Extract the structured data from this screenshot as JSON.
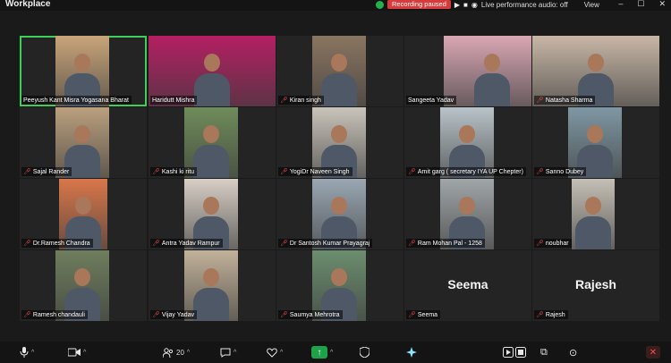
{
  "app": {
    "title": "Workplace"
  },
  "status": {
    "recording": "Recording paused",
    "live_audio": "Live performance audio: off",
    "view": "View"
  },
  "window_controls": {
    "minimize": "–",
    "maximize": "☐",
    "close": "✕"
  },
  "participants": [
    {
      "name": "Peeyush Kant Misra Yogasana Bharat",
      "muted": false,
      "speaking": true,
      "bg": "#c9a57a"
    },
    {
      "name": "Haridutt Mishra",
      "muted": false,
      "speaking": false,
      "bg": "#b41f62"
    },
    {
      "name": "Kiran singh",
      "muted": true,
      "speaking": false,
      "bg": "#8a7560"
    },
    {
      "name": "Sangeeta Yadav",
      "muted": false,
      "speaking": false,
      "bg": "#d9a7b4"
    },
    {
      "name": "Natasha Sharma",
      "muted": true,
      "speaking": false,
      "bg": "#c8b7a6"
    },
    {
      "name": "Sajal Rander",
      "muted": true,
      "speaking": false,
      "bg": "#bba07e"
    },
    {
      "name": "Kashi ki ritu",
      "muted": true,
      "speaking": false,
      "bg": "#6f8c5a"
    },
    {
      "name": "YogiDr Naveen Singh",
      "muted": true,
      "speaking": false,
      "bg": "#c9c4bb"
    },
    {
      "name": "Amit garg ( secretary IYA UP Chepter)",
      "muted": true,
      "speaking": false,
      "bg": "#b9c3c9"
    },
    {
      "name": "Sanno Dubey",
      "muted": true,
      "speaking": false,
      "bg": "#7f97a3"
    },
    {
      "name": "Dr.Ramesh Chandra",
      "muted": true,
      "speaking": false,
      "bg": "#d9774a"
    },
    {
      "name": "Antra Yadav Rampur",
      "muted": true,
      "speaking": false,
      "bg": "#d8cfc6"
    },
    {
      "name": "Dr Santosh Kumar Prayagraj",
      "muted": true,
      "speaking": false,
      "bg": "#9aa7b3"
    },
    {
      "name": "Ram Mohan Pal - 1258",
      "muted": true,
      "speaking": false,
      "bg": "#a0a6a8"
    },
    {
      "name": "noubhar",
      "muted": true,
      "speaking": false,
      "bg": "#c5c0b6"
    },
    {
      "name": "Ramesh chandauli",
      "muted": true,
      "speaking": false,
      "bg": "#6f7e5e"
    },
    {
      "name": "Vijay Yadav",
      "muted": true,
      "speaking": false,
      "bg": "#c2b29a"
    },
    {
      "name": "Saumya Mehrotra",
      "muted": true,
      "speaking": false,
      "bg": "#6c8e6f"
    },
    {
      "name": "Seema",
      "muted": true,
      "speaking": false,
      "bg": "",
      "big": "Seema"
    },
    {
      "name": "Rajesh",
      "muted": true,
      "speaking": false,
      "bg": "",
      "big": "Rajesh"
    }
  ],
  "toolbar": {
    "participants_count": "20",
    "icons": [
      "microphone-icon",
      "video-camera-icon",
      "participants-icon",
      "chat-icon",
      "reactions-icon",
      "share-screen-icon",
      "security-icon",
      "ai-companion-icon",
      "record-icon",
      "apps-icon",
      "more-icon",
      "end-icon"
    ]
  }
}
